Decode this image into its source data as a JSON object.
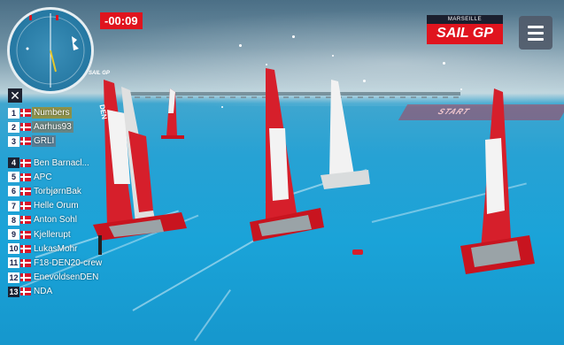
{
  "hud": {
    "timer": "-00:09",
    "logo_top": "MARSEILLE",
    "logo_main": "SAIL GP",
    "close_glyph": "✕",
    "start_line_label": "START",
    "icons": [
      "compass-minimap-icon",
      "menu-icon",
      "close-icon",
      "denmark-flag-icon"
    ]
  },
  "leaderboard": [
    {
      "rank": "1",
      "name": "Numbers"
    },
    {
      "rank": "2",
      "name": "Aarhus93"
    },
    {
      "rank": "3",
      "name": "GRLI"
    },
    {
      "rank": "4",
      "name": "Ben Barnacl..."
    },
    {
      "rank": "5",
      "name": "APC"
    },
    {
      "rank": "6",
      "name": "TorbjørnBak"
    },
    {
      "rank": "7",
      "name": "Helle Orum"
    },
    {
      "rank": "8",
      "name": "Anton Sohl"
    },
    {
      "rank": "9",
      "name": "Kjellerupt"
    },
    {
      "rank": "10",
      "name": "LukasMohr"
    },
    {
      "rank": "11",
      "name": "F18-DEN20-crew"
    },
    {
      "rank": "12",
      "name": "EnevoldsenDEN"
    },
    {
      "rank": "13",
      "name": "NDA"
    }
  ],
  "sail_text": {
    "team_code": "DEN",
    "brand": "SAIL GP"
  },
  "colors": {
    "water": "#1aa3d8",
    "timer_bg": "#e0141e",
    "logo_bg": "#e0141e",
    "sail_red": "#d61f2b",
    "hull_red": "#c8141f"
  }
}
